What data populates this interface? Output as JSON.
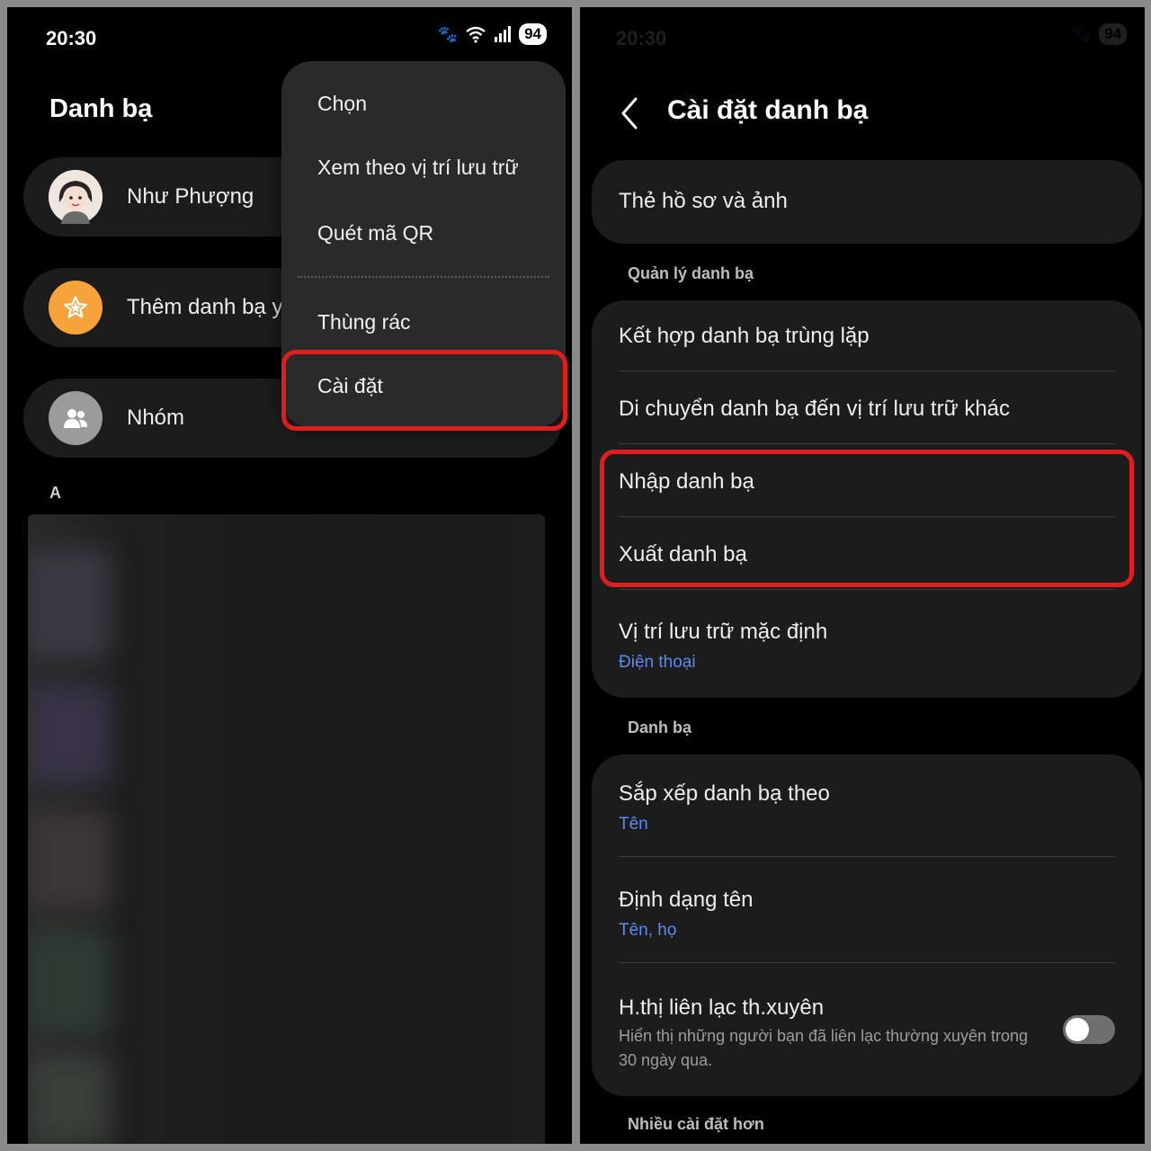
{
  "left": {
    "status_bar": {
      "time": "20:30",
      "battery": "94",
      "icons": [
        "paw-icon",
        "wifi-icon",
        "signal-icon"
      ]
    },
    "title": "Danh bạ",
    "profile_name": "Như Phượng",
    "add_favorites_label": "Thêm danh bạ y",
    "groups_label": "Nhóm",
    "section_letter": "A",
    "menu": {
      "items": [
        {
          "label": "Chọn"
        },
        {
          "label": "Xem theo vị trí lưu trữ"
        },
        {
          "label": "Quét mã QR"
        },
        {
          "label": "Thùng rác"
        },
        {
          "label": "Cài đặt"
        }
      ],
      "highlighted": "Cài đặt"
    }
  },
  "right": {
    "status_bar": {
      "time": "20:30",
      "battery": "94"
    },
    "title": "Cài đặt danh bạ",
    "profile_card": "Thẻ hồ sơ và ảnh",
    "manage_section": {
      "header": "Quản lý danh bạ",
      "items": [
        {
          "title": "Kết hợp danh bạ trùng lặp"
        },
        {
          "title": "Di chuyển danh bạ đến vị trí lưu trữ khác"
        },
        {
          "title": "Nhập danh bạ"
        },
        {
          "title": "Xuất danh bạ"
        },
        {
          "title": "Vị trí lưu trữ mặc định",
          "value": "Điện thoại"
        }
      ]
    },
    "contacts_section": {
      "header": "Danh bạ",
      "items": [
        {
          "title": "Sắp xếp danh bạ theo",
          "value": "Tên"
        },
        {
          "title": "Định dạng tên",
          "value": "Tên, họ"
        },
        {
          "title": "H.thị liên lạc th.xuyên",
          "description": "Hiển thị những người bạn đã liên lạc thường xuyên trong 30 ngày qua.",
          "toggle_on": false
        }
      ]
    },
    "more_section_header": "Nhiều cài đặt hơn"
  },
  "colors": {
    "highlight": "#e11d1d",
    "accent_link": "#5a8cf0",
    "favorites_badge": "#f5a33a",
    "card": "#1c1c1c",
    "menu": "#2a2a2a"
  }
}
